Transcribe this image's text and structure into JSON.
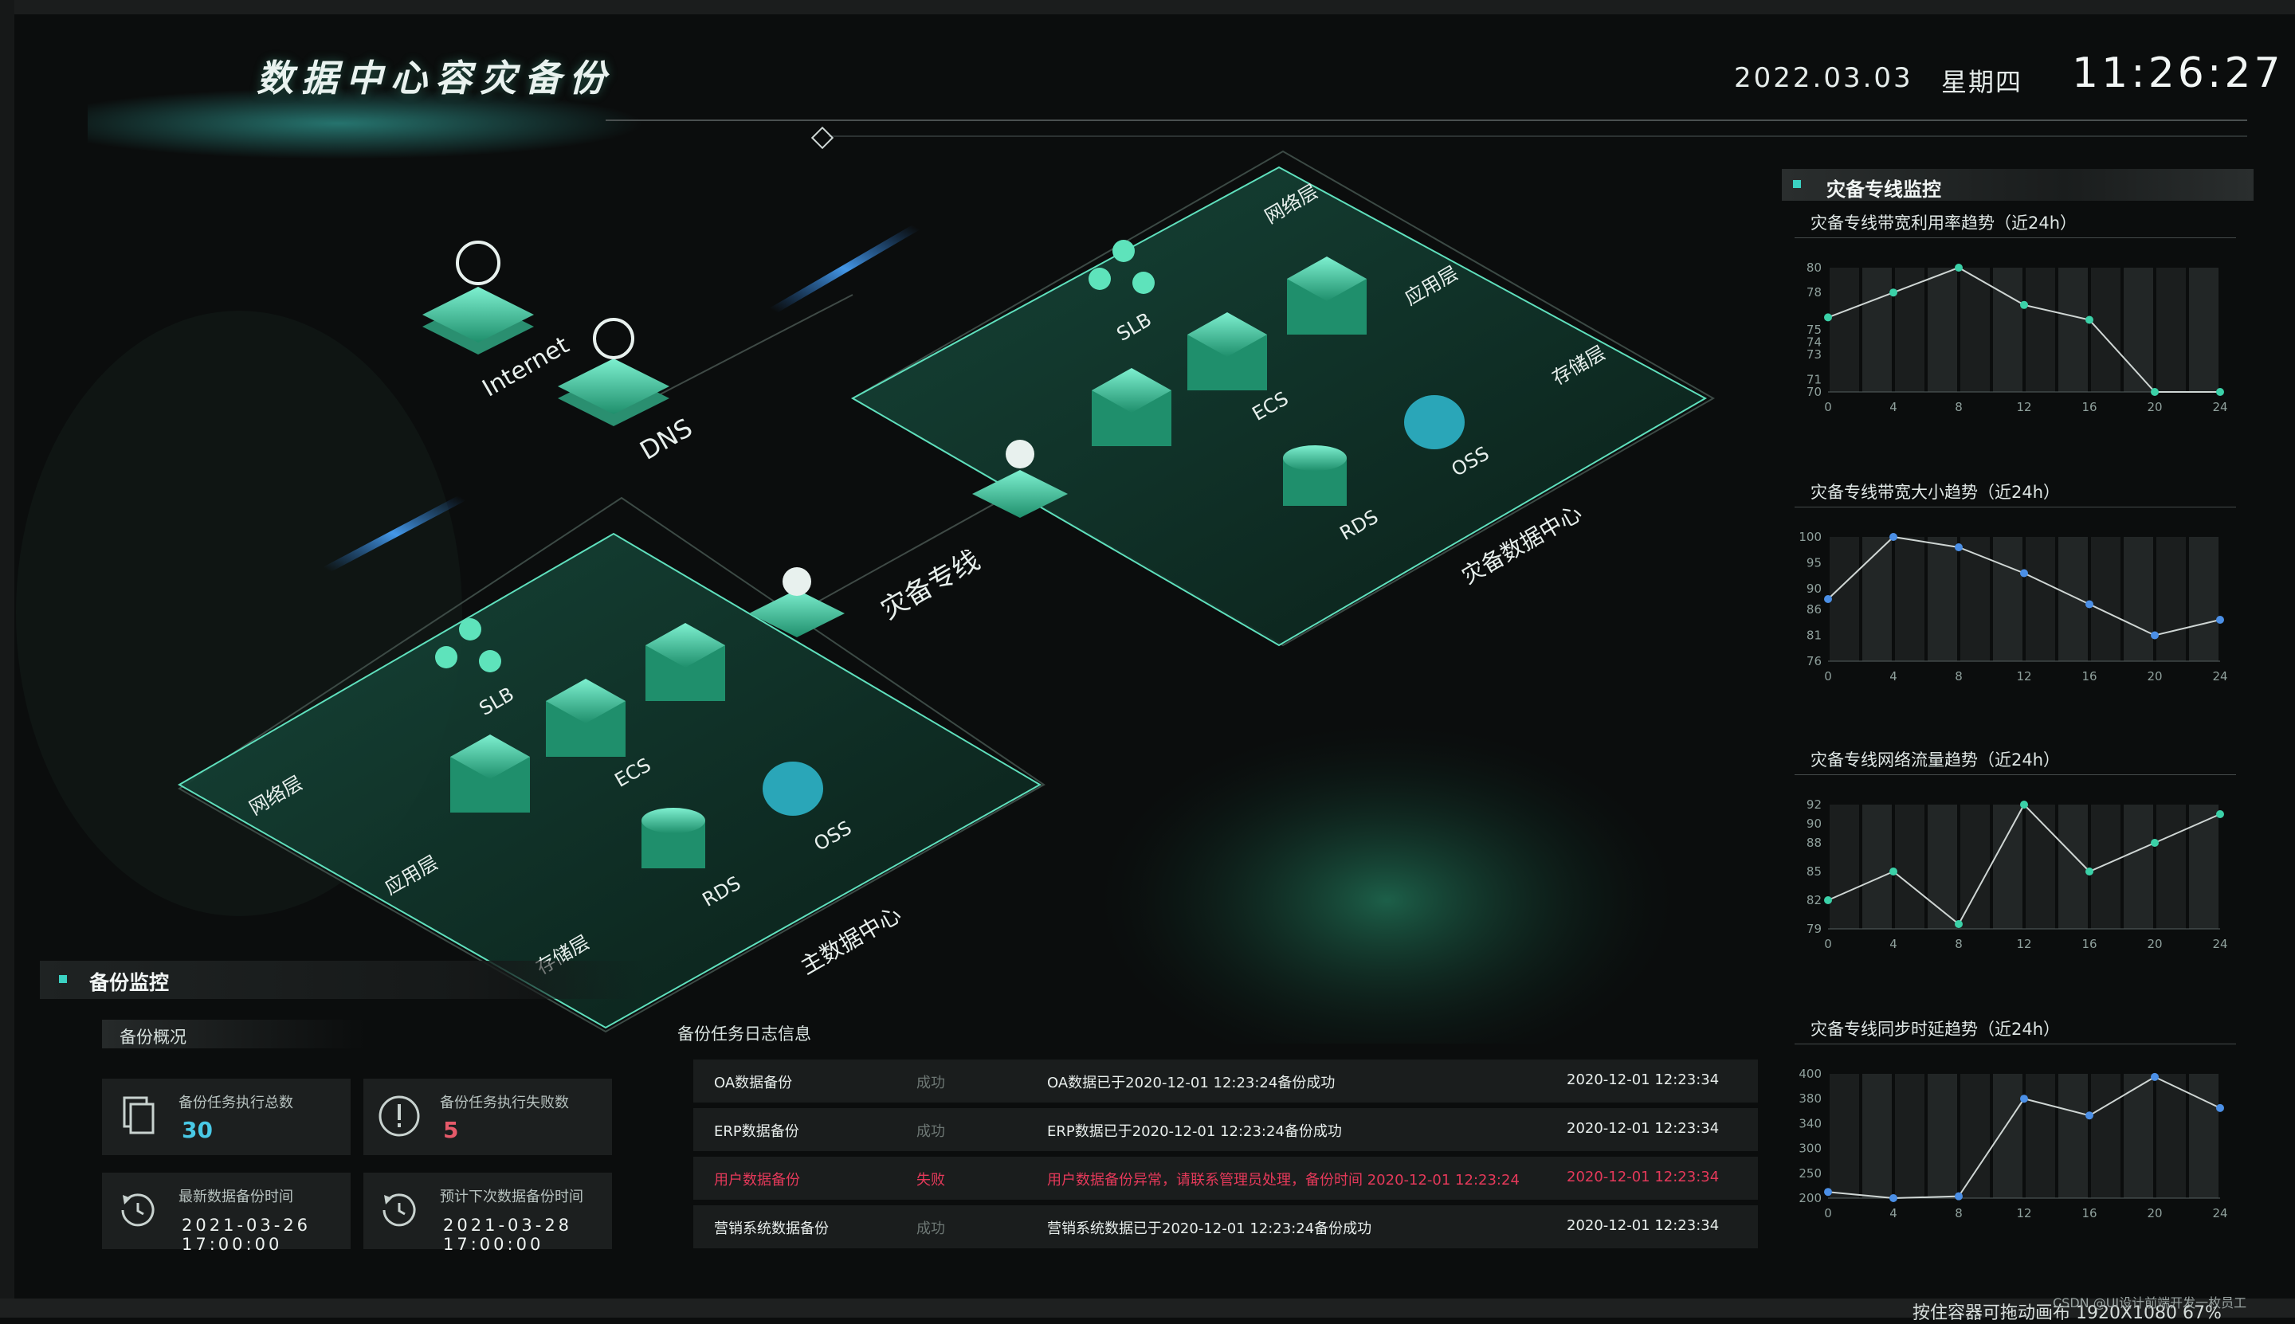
{
  "header": {
    "title": "数据中心容灾备份",
    "date": "2022.03.03",
    "weekday": "星期四",
    "time": "11:26:27"
  },
  "diagram": {
    "main_center": {
      "name": "主数据中心",
      "layers": [
        "网络层",
        "应用层",
        "存储层"
      ],
      "nodes": [
        "SLB",
        "ECS",
        "RDS",
        "OSS"
      ]
    },
    "dr_center": {
      "name": "灾备数据中心",
      "layers": [
        "网络层",
        "应用层",
        "存储层"
      ],
      "nodes": [
        "SLB",
        "ECS",
        "RDS",
        "OSS"
      ]
    },
    "link_label": "灾备专线",
    "internet_label": "Internet",
    "dns_label": "DNS"
  },
  "right_panel": {
    "title": "灾备专线监控",
    "charts": [
      {
        "title": "灾备专线带宽利用率趋势（近24h）"
      },
      {
        "title": "灾备专线带宽大小趋势（近24h）"
      },
      {
        "title": "灾备专线网络流量趋势（近24h）"
      },
      {
        "title": "灾备专线同步时延趋势（近24h）"
      }
    ]
  },
  "chart_data": [
    {
      "type": "line",
      "title": "灾备专线带宽利用率趋势（近24h）",
      "x": [
        0,
        4,
        8,
        12,
        16,
        20,
        24
      ],
      "y": [
        76,
        78,
        80,
        77,
        75.8,
        70,
        70
      ],
      "yticks": [
        70,
        71,
        73,
        74,
        75,
        78,
        80
      ],
      "xlim": [
        0,
        24
      ]
    },
    {
      "type": "line",
      "title": "灾备专线带宽大小趋势（近24h）",
      "x": [
        0,
        4,
        8,
        12,
        16,
        20,
        24
      ],
      "y": [
        88,
        100,
        98,
        93,
        87,
        81,
        84
      ],
      "yticks": [
        76,
        81,
        86,
        90,
        95,
        100
      ],
      "xlim": [
        0,
        24
      ]
    },
    {
      "type": "line",
      "title": "灾备专线网络流量趋势（近24h）",
      "x": [
        0,
        4,
        8,
        12,
        16,
        20,
        24
      ],
      "y": [
        82,
        85,
        79.5,
        92,
        85,
        88,
        91
      ],
      "yticks": [
        79,
        82,
        85,
        88,
        90,
        92
      ],
      "xlim": [
        0,
        24
      ]
    },
    {
      "type": "line",
      "title": "灾备专线同步时延趋势（近24h）",
      "x": [
        0,
        4,
        8,
        12,
        16,
        20,
        24
      ],
      "y": [
        210,
        200,
        203,
        360,
        333,
        395,
        345
      ],
      "yticks": [
        200,
        240,
        280,
        320,
        360,
        400
      ],
      "ytick_labels": [
        "200",
        "250",
        "300",
        "340",
        "380",
        "400"
      ],
      "xlim": [
        0,
        24
      ]
    }
  ],
  "backup": {
    "title": "备份监控",
    "overview_title": "备份概况",
    "stats": [
      {
        "label": "备份任务执行总数",
        "value": "30"
      },
      {
        "label": "备份任务执行失败数",
        "value": "5"
      },
      {
        "label": "最新数据备份时间",
        "value": "2021-03-26 17:00:00"
      },
      {
        "label": "预计下次数据备份时间",
        "value": "2021-03-28 17:00:00"
      }
    ],
    "log_title": "备份任务日志信息",
    "logs": [
      {
        "task": "OA数据备份",
        "status": "成功",
        "message": "OA数据已于2020-12-01 12:23:24备份成功",
        "time": "2020-12-01 12:23:34",
        "error": false
      },
      {
        "task": "ERP数据备份",
        "status": "成功",
        "message": "ERP数据已于2020-12-01 12:23:24备份成功",
        "time": "2020-12-01 12:23:34",
        "error": false
      },
      {
        "task": "用户数据备份",
        "status": "失败",
        "message": "用户数据备份异常，请联系管理员处理，备份时间 2020-12-01 12:23:24",
        "time": "2020-12-01 12:23:34",
        "error": true
      },
      {
        "task": "营销系统数据备份",
        "status": "成功",
        "message": "营销系统数据已于2020-12-01 12:23:24备份成功",
        "time": "2020-12-01 12:23:34",
        "error": false
      }
    ]
  },
  "footer": {
    "note": "按住容器可拖动画布  1920X1080 67%",
    "credit": "CSDN @UI设计前端开发一枚员工"
  },
  "colors": {
    "accent": "#3bd1c2",
    "value": "#49c9e6",
    "error": "#e5395a",
    "platform": "#0f2f26",
    "node": "#38c9a0"
  }
}
